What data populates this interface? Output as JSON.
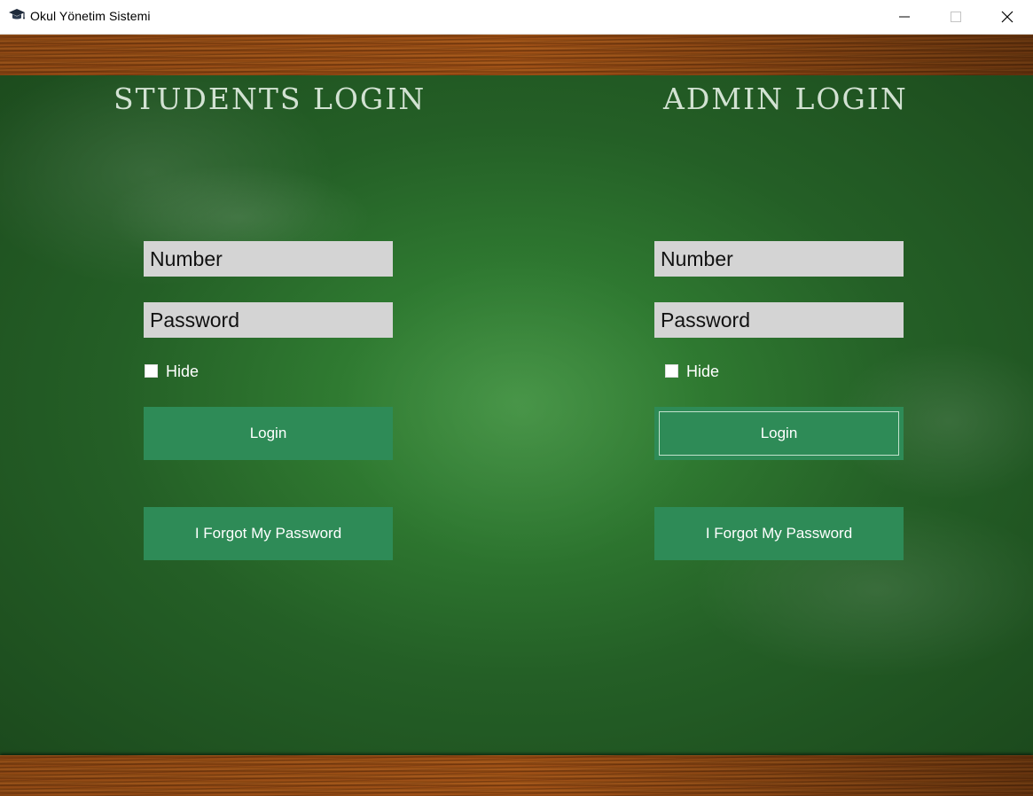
{
  "window": {
    "title": "Okul Yönetim Sistemi",
    "icon": "graduation-cap-icon"
  },
  "students": {
    "heading": "STUDENTS LOGIN",
    "number_placeholder": "Number",
    "password_placeholder": "Password",
    "hide_label": "Hide",
    "hide_checked": false,
    "login_label": "Login",
    "forgot_label": "I Forgot My Password"
  },
  "admin": {
    "heading": "ADMIN LOGIN",
    "number_placeholder": "Number",
    "password_placeholder": "Password",
    "hide_label": "Hide",
    "hide_checked": false,
    "login_label": "Login",
    "forgot_label": "I Forgot My Password"
  },
  "colors": {
    "button": "#2e8b57",
    "field": "#d4d4d4",
    "board": "#2f7a31",
    "wood": "#8a4610"
  }
}
